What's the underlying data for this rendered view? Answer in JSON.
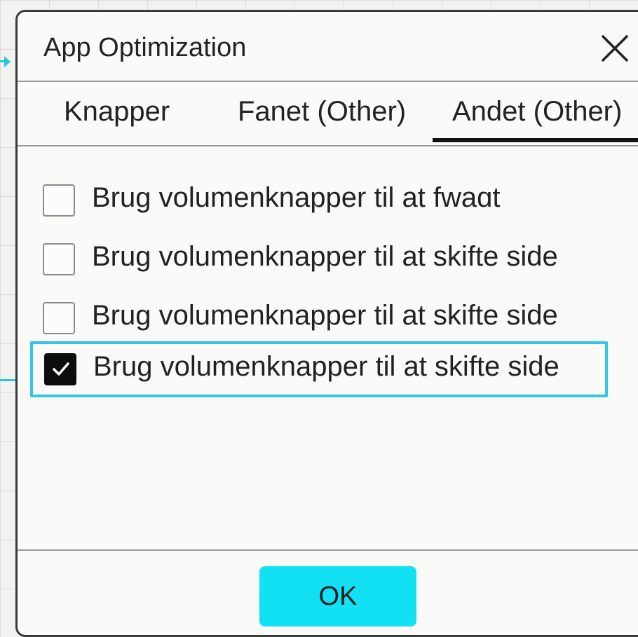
{
  "dialog": {
    "title": "App Optimization",
    "close_icon": "close-icon"
  },
  "tabs": [
    {
      "label": "Knapper",
      "selected": false
    },
    {
      "label": "Fanet (Other)",
      "selected": false
    },
    {
      "label": "Andet (Other)",
      "selected": true
    }
  ],
  "options": [
    {
      "label": "Brug volumenknapper til at fwaɑt",
      "checked": false
    },
    {
      "label": "Brug volumenknapper til at skifte side",
      "checked": false
    },
    {
      "label": "Brug volumenknapper til at skifte side",
      "checked": false
    },
    {
      "label": "Brug volumenknapper til at skifte side",
      "checked": true,
      "highlighted": true
    }
  ],
  "footer": {
    "ok_label": "OK"
  },
  "colors": {
    "accent": "#12e1f4",
    "highlight_border": "#35c6e3",
    "checkbox_checked": "#0d0d0d"
  }
}
